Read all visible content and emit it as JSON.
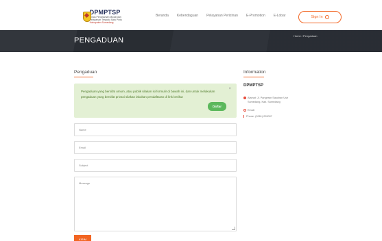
{
  "header": {
    "logo": {
      "title": "DPMPTSP",
      "subtitle": "Dinas Penanaman Modal dan Pelayanan Terpadu Satu Pintu",
      "region": "Kabupaten Sumedang"
    },
    "nav": [
      "Beranda",
      "Kebendaguan",
      "Pelayanan Perizinan",
      "E-Promotion",
      "E-Lobar"
    ],
    "signin_label": "Sign In"
  },
  "banner": {
    "title": "PENGADUAN",
    "breadcrumb": "Home / Pengaduan"
  },
  "form": {
    "section_title": "Pengaduan",
    "alert_text": "Pengaduan yang bersifat umum, atau publik silakan isi formulir di bawah ini, dan untuk melakukan pengaduan yang bersifat privasi silakan lakukan pendaftaran di link berikut",
    "alert_close": "×",
    "daftar_label": "Daftar",
    "name_placeholder": "Name",
    "email_placeholder": "Email",
    "subject_placeholder": "Subject",
    "message_placeholder": "Message",
    "submit_label": "KIRIM"
  },
  "info": {
    "section_title": "Information",
    "org_name": "DPMPTSP",
    "address": "Alamat: Jl. Pangeran Sasuhan Usir Sumedang, Kab. Sumedang",
    "email": "Email:",
    "phone": "Phone: (0261) 209007"
  },
  "colors": {
    "accent": "#f26522",
    "banner": "#2b2f36",
    "alert_bg": "#e3f0d4",
    "success": "#5cb85c"
  }
}
